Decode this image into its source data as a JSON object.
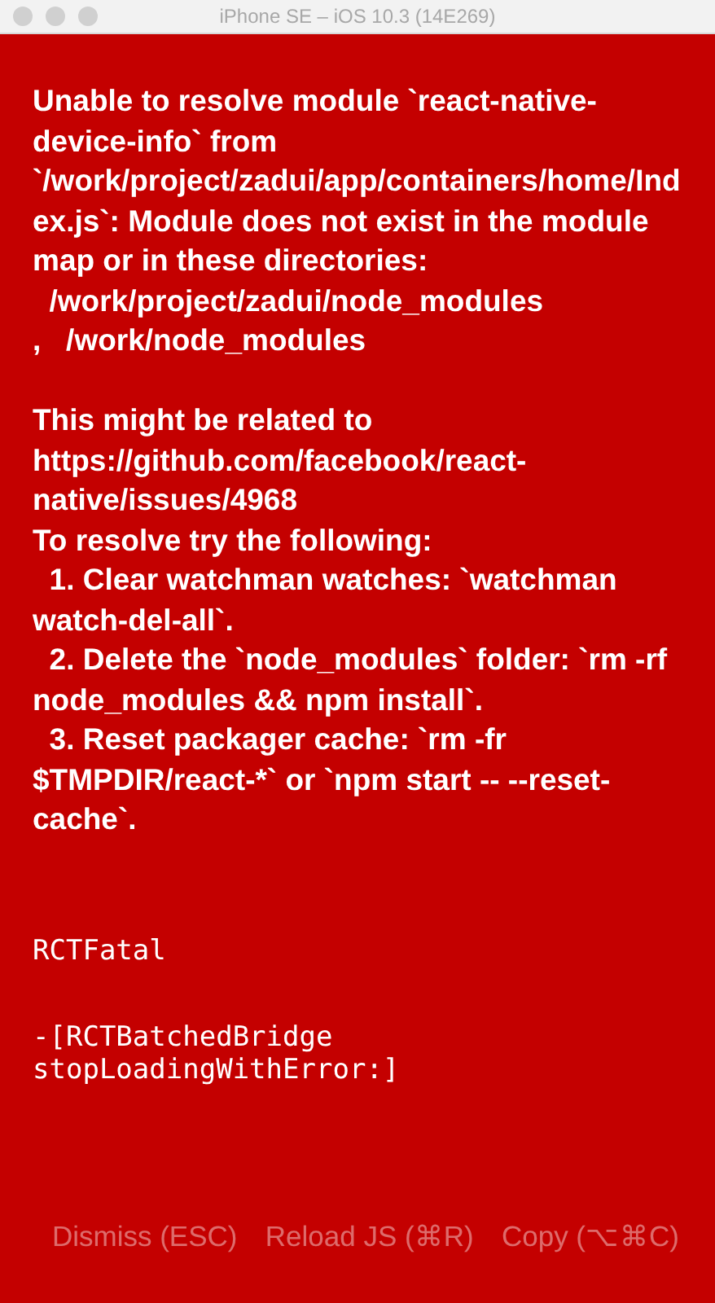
{
  "window": {
    "title": "iPhone SE – iOS 10.3 (14E269)"
  },
  "error": {
    "message": "Unable to resolve module `react-native-device-info` from `/work/project/zadui/app/containers/home/Index.js`: Module does not exist in the module map or in these directories:\n  /work/project/zadui/node_modules\n,   /work/node_modules\n\nThis might be related to https://github.com/facebook/react-native/issues/4968\nTo resolve try the following:\n  1. Clear watchman watches: `watchman watch-del-all`.\n  2. Delete the `node_modules` folder: `rm -rf node_modules && npm install`.\n  3. Reset packager cache: `rm -fr $TMPDIR/react-*` or `npm start -- --reset-cache`.",
    "stack": [
      "RCTFatal",
      "-[RCTBatchedBridge stopLoadingWithError:]"
    ]
  },
  "buttons": [
    "Dismiss (ESC)",
    "Reload JS (⌘R)",
    "Copy (⌥⌘C)"
  ]
}
